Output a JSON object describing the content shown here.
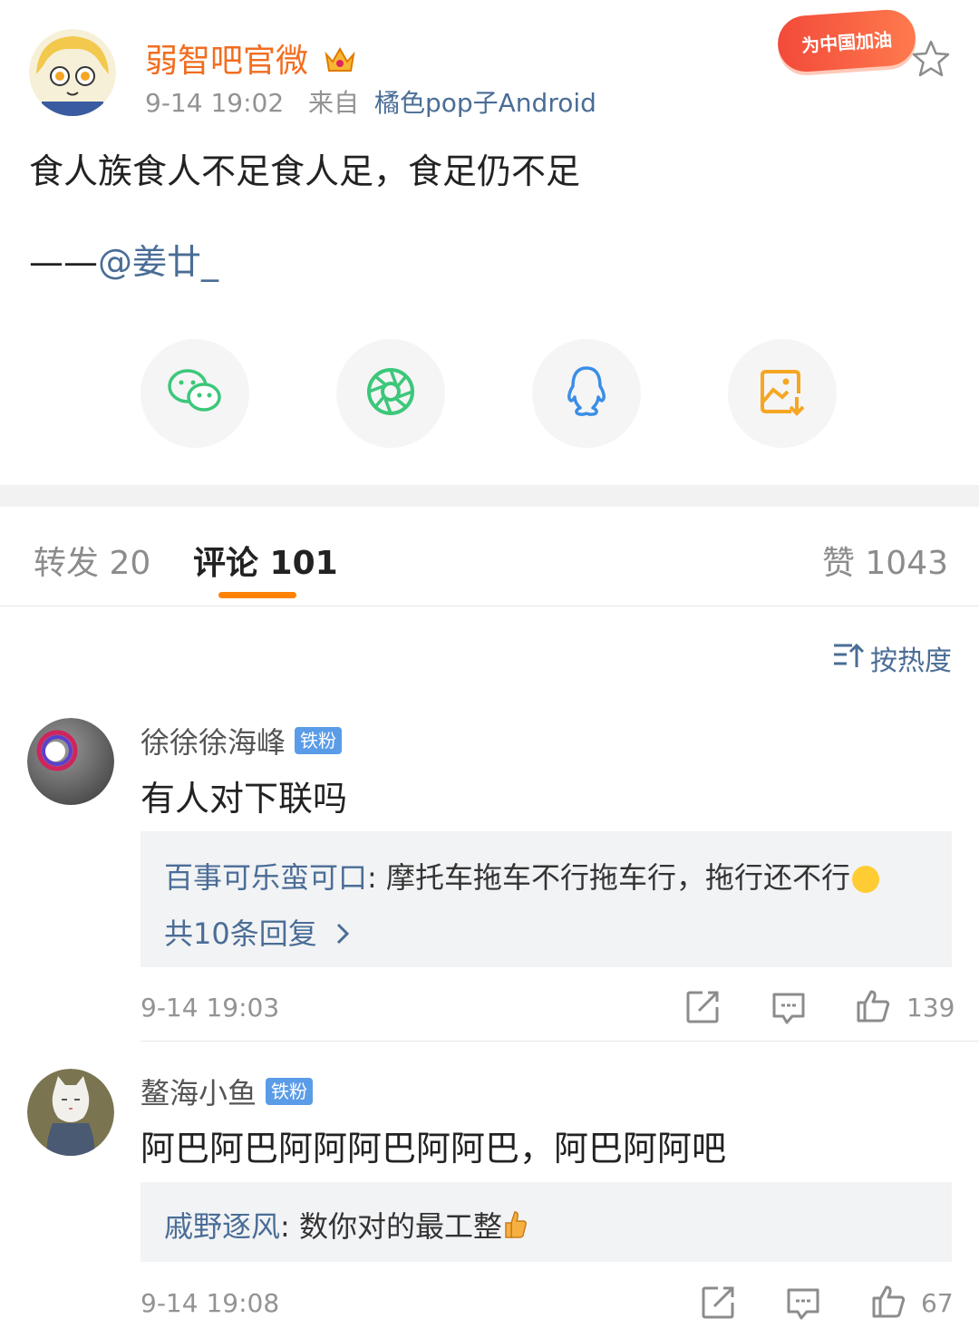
{
  "post": {
    "author": "弱智吧官微",
    "time": "9-14 19:02",
    "source_prefix": "来自",
    "source": "橘色pop子Android",
    "badge": "为中国加油",
    "text": "食人族食人不足食人足，食足仍不足",
    "credit_dash": "——",
    "credit_user": "@姜廿_"
  },
  "share_icons": [
    "wechat-icon",
    "moments-icon",
    "qq-icon",
    "save-image-icon"
  ],
  "tabs": {
    "repost": "转发 20",
    "comments": "评论 101",
    "likes": "赞 1043"
  },
  "sort_label": "按热度",
  "comments": [
    {
      "user": "徐徐徐海峰",
      "badge": "铁粉",
      "text": "有人对下联吗",
      "reply_user": "百事可乐蛮可口",
      "reply_text": ": 摩托车拖车不行拖车行，拖行还不行",
      "more": "共10条回复",
      "time": "9-14 19:03",
      "likes": "139"
    },
    {
      "user": "鳌海小鱼",
      "badge": "铁粉",
      "text": "阿巴阿巴阿阿阿巴阿阿巴，阿巴阿阿吧",
      "reply_user": "戚野逐风",
      "reply_text": ": 数你对的最工整",
      "time": "9-14 19:08",
      "likes": "67"
    }
  ],
  "colors": {
    "accent": "#ff8200",
    "link": "#4a6d96",
    "name": "#f26d1f"
  }
}
